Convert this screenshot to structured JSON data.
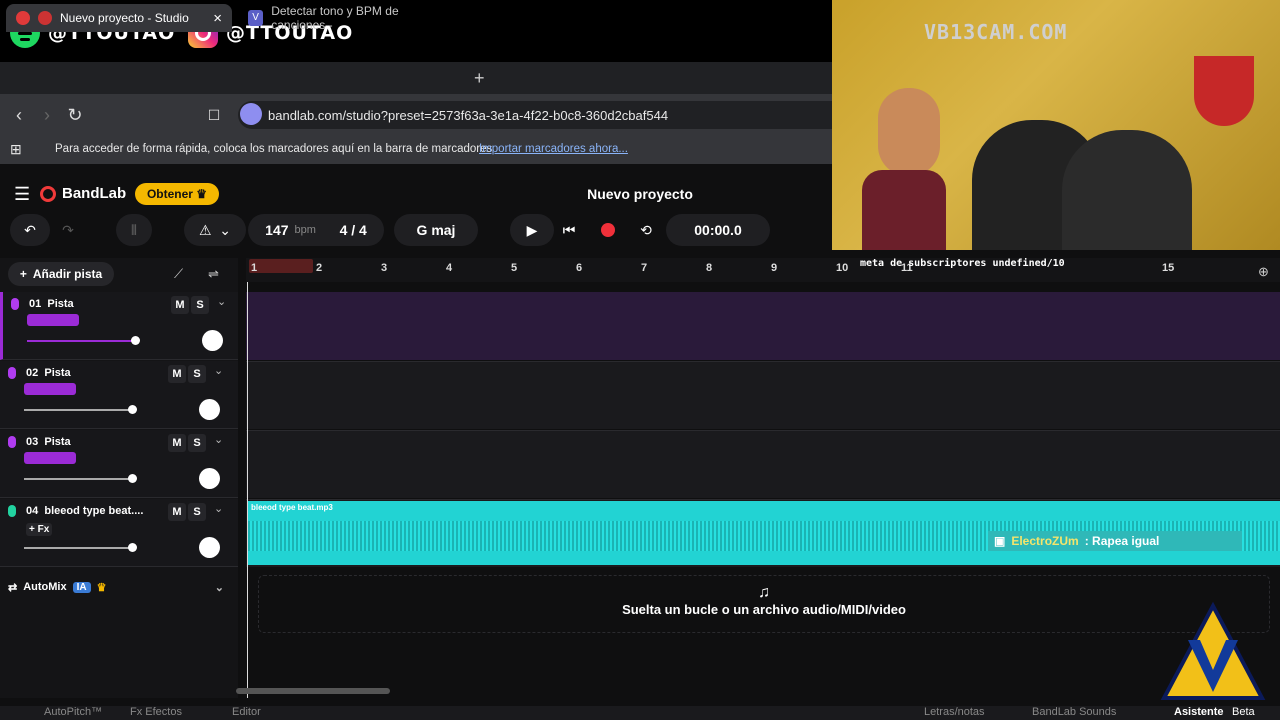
{
  "social": {
    "spotify_handle": "@TTOUTAO",
    "instagram_handle": "@TTOUTAO"
  },
  "browser": {
    "tabs": [
      {
        "label": "Nuevo proyecto - Studio",
        "close": "×"
      },
      {
        "label": "Detectar tono y BPM de canciones -",
        "icon": "V"
      }
    ],
    "new_tab": "+",
    "url": "bandlab.com/studio?preset=2573f63a-3e1a-4f22-b0c8-360d2cbaf544",
    "bookmark_hint": "Para acceder de forma rápida, coloca los marcadores aquí en la barra de marcadores",
    "bookmark_link": "Importar marcadores ahora..."
  },
  "app": {
    "brand": "BandLab",
    "obtener": "Obtener",
    "project_title": "Nuevo proyecto",
    "bpm": "147",
    "bpm_unit": "bpm",
    "time_sig": "4 / 4",
    "key": "G maj",
    "time": "00:00.0",
    "add_track": "Añadir pista",
    "timeline_ticks": [
      "1",
      "2",
      "3",
      "4",
      "5",
      "6",
      "7",
      "8",
      "9",
      "10",
      "11",
      "15"
    ],
    "tracks": [
      {
        "num": "01",
        "name": "Pista",
        "color": "#b03cf0"
      },
      {
        "num": "02",
        "name": "Pista",
        "color": "#b03cf0"
      },
      {
        "num": "03",
        "name": "Pista",
        "color": "#b03cf0"
      },
      {
        "num": "04",
        "name": "bleeod type beat....",
        "color": "#22d3a0",
        "fx": "+ Fx"
      }
    ],
    "mute": "M",
    "solo": "S",
    "automix": "AutoMix",
    "automix_badge": "IA",
    "clip_name": "bleeod type beat.mp3",
    "drop_text": "Suelta un bucle o un archivo audio/MIDI/video",
    "bottom": [
      "AutoPitch™",
      "Fx  Efectos",
      "Editor",
      "Letras/notas",
      "BandLab Sounds",
      "Asistente"
    ],
    "bottom_beta": "Beta"
  },
  "overlay": {
    "webcam_watermark": "VB13CAM.COM",
    "chat_user": "ElectroZUm",
    "chat_msg": ": Rapea igual",
    "ticker": "meta de subscriptores undefined/10"
  }
}
